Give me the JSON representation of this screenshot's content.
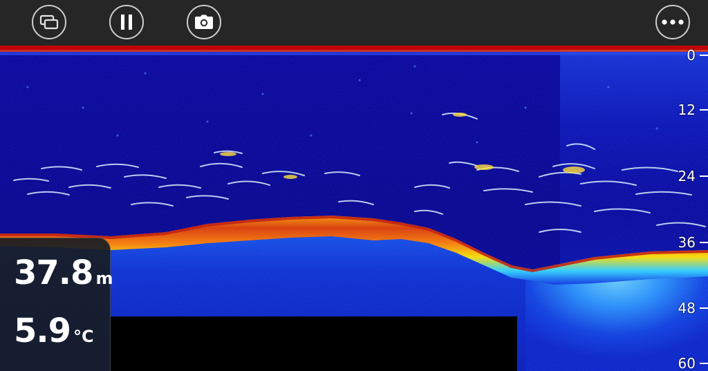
{
  "toolbar": {
    "buttons": [
      {
        "id": "layers",
        "icon": "layers-icon"
      },
      {
        "id": "pause",
        "icon": "pause-icon"
      },
      {
        "id": "camera",
        "icon": "camera-icon"
      },
      {
        "id": "more",
        "icon": "more-dots-icon"
      }
    ]
  },
  "depth_scale": {
    "ticks": [
      "0",
      "12",
      "24",
      "36",
      "48",
      "60"
    ]
  },
  "readout": {
    "depth_value": "37.8",
    "depth_unit": "m",
    "temp_value": "5.9",
    "temp_unit": "°C"
  },
  "colors": {
    "toolbar_bg": "#262626",
    "water_deep": "#05008f",
    "water_mid": "#0a1fd0",
    "bottom_hot": "#e03000",
    "bottom_warm": "#ffd800",
    "surface_line": "#c00000",
    "fish_arch": "#cfe8ff"
  }
}
